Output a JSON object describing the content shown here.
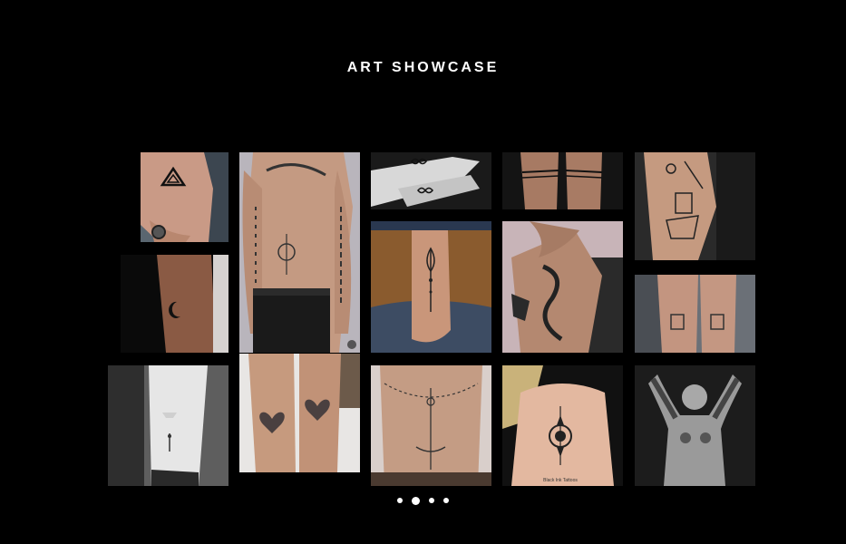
{
  "header": {
    "title": "ART SHOWCASE"
  },
  "gallery": {
    "tiles": [
      {
        "name": "tile-hand-triangle-tattoo",
        "subject": "hand-triangle"
      },
      {
        "name": "tile-torso-arm-tattoos",
        "subject": "torso"
      },
      {
        "name": "tile-fingers-infinity-tattoo",
        "subject": "fingers"
      },
      {
        "name": "tile-forearm-bands-tattoo",
        "subject": "bands"
      },
      {
        "name": "tile-calf-geometric-tattoo",
        "subject": "calf"
      },
      {
        "name": "tile-wrist-moon-tattoo",
        "subject": "moon"
      },
      {
        "name": "tile-ankle-lotus-tattoo",
        "subject": "ankle"
      },
      {
        "name": "tile-arm-snake-tattoo",
        "subject": "snake"
      },
      {
        "name": "tile-wrist-stamps-tattoo",
        "subject": "stamps"
      },
      {
        "name": "tile-forearm-minimal-tattoo",
        "subject": "forearm"
      },
      {
        "name": "tile-matching-heart-tattoos",
        "subject": "hearts"
      },
      {
        "name": "tile-back-spine-tattoo",
        "subject": "spine"
      },
      {
        "name": "tile-upper-back-mandala-tattoo",
        "subject": "mandala"
      },
      {
        "name": "tile-man-full-sleeve-tattoos",
        "subject": "man"
      }
    ],
    "mandala_caption": "Black Ink Tattoos"
  },
  "pagination": {
    "pages": 4,
    "active_page": 2
  },
  "colors": {
    "background": "#000000",
    "title": "#ffffff",
    "dot": "#ffffff"
  }
}
